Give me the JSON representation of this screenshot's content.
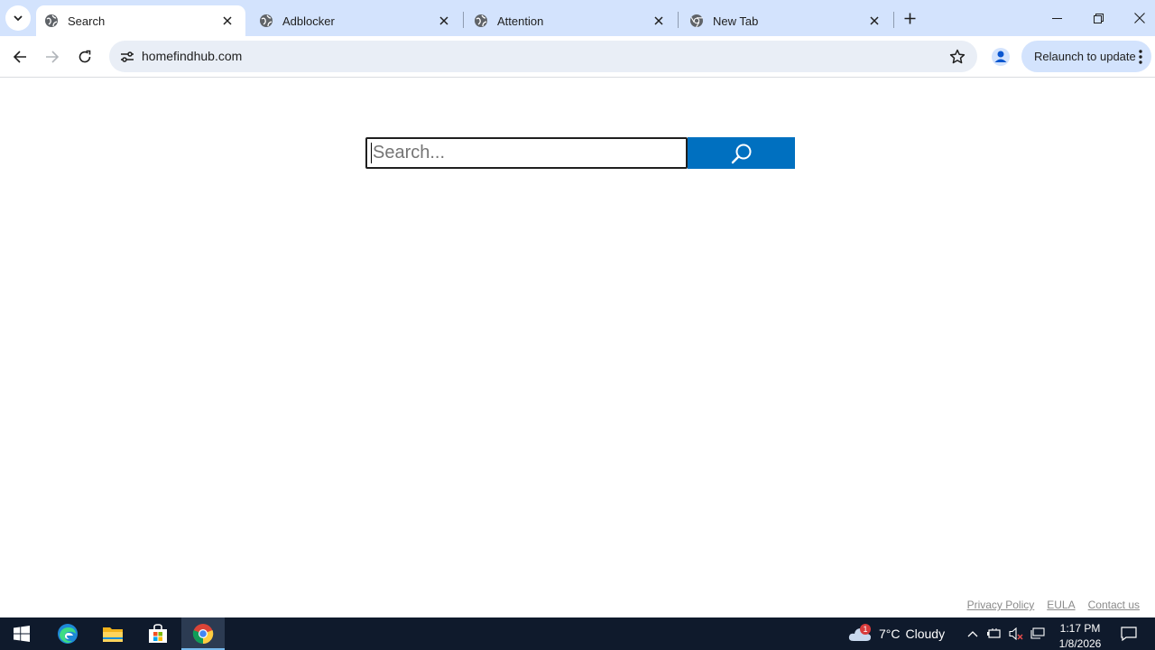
{
  "browser": {
    "tabs": [
      {
        "title": "Search",
        "active": true,
        "favicon": "globe-icon"
      },
      {
        "title": "Adblocker",
        "active": false,
        "favicon": "globe-icon"
      },
      {
        "title": "Attention",
        "active": false,
        "favicon": "globe-icon"
      },
      {
        "title": "New Tab",
        "active": false,
        "favicon": "chrome-icon"
      }
    ],
    "url": "homefindhub.com",
    "relaunch_label": "Relaunch to update"
  },
  "page": {
    "search_placeholder": "Search...",
    "search_button_color": "#0070c0",
    "footer_links": [
      "Privacy Policy",
      "EULA",
      "Contact us"
    ]
  },
  "taskbar": {
    "apps": [
      "windows-start-icon",
      "edge-icon",
      "file-explorer-icon",
      "microsoft-store-icon",
      "chrome-icon"
    ],
    "weather": {
      "temp": "7°C",
      "condition": "Cloudy",
      "badge": "1"
    },
    "clock": {
      "time": "1:17 PM",
      "date": "1/8/2026"
    }
  },
  "colors": {
    "tabstrip_bg": "#d3e3fd",
    "omnibox_bg": "#e9eef6",
    "taskbar_bg": "#0f1a2c"
  }
}
